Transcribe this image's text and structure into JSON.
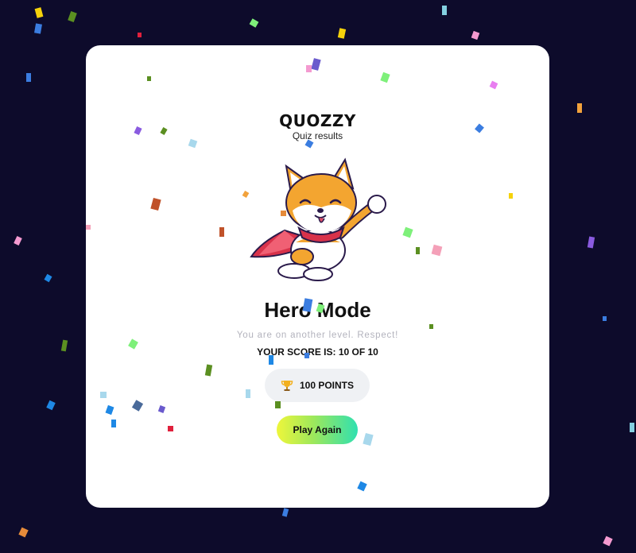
{
  "app": {
    "brand": "QUOZZY",
    "subtitle": "Quiz results"
  },
  "result": {
    "title": "Hero Mode",
    "tagline": "You are on another level. Respect!",
    "score_text": "YOUR SCORE IS: 10 OF 10",
    "points_label": "100 POINTS",
    "play_again_label": "Play Again"
  },
  "mascot": {
    "icon": "superhero-shiba-dog-illustration"
  },
  "colors": {
    "background": "#0d0b2b",
    "card": "#ffffff",
    "button_gradient": [
      "#eef63b",
      "#9ee85b",
      "#2fe0b0"
    ],
    "confetti": [
      "#f5d20b",
      "#5b8f21",
      "#3b7de0",
      "#7ef07a",
      "#e0203c",
      "#f49ad0",
      "#8a5be0",
      "#1e88e5",
      "#f2a23c",
      "#c0522a",
      "#84d0e0",
      "#6a5acd",
      "#e68b3a",
      "#a6e45a"
    ]
  }
}
